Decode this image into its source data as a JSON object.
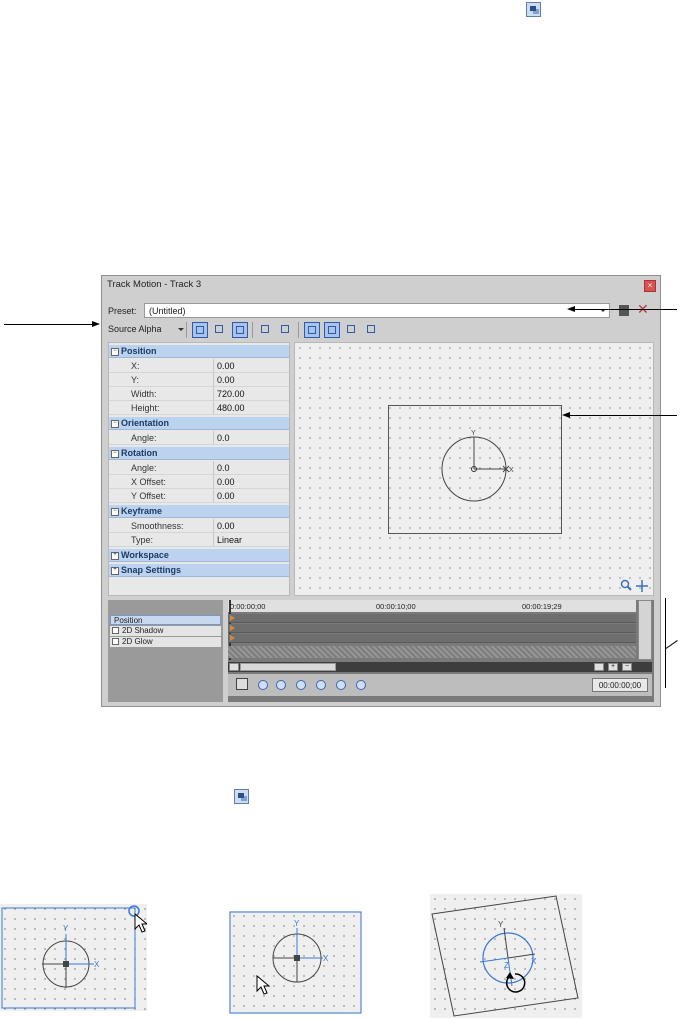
{
  "window": {
    "title": "Track Motion - Track 3",
    "close_symbol": "×"
  },
  "preset": {
    "label": "Preset:",
    "value": "(Untitled)",
    "delete_symbol": "✕"
  },
  "toolbar": {
    "source_alpha_label": "Source Alpha"
  },
  "properties": {
    "groups": [
      {
        "label": "Position",
        "expander": "−",
        "rows": [
          {
            "key": "X:",
            "value": "0.00"
          },
          {
            "key": "Y:",
            "value": "0.00"
          },
          {
            "key": "Width:",
            "value": "720.00"
          },
          {
            "key": "Height:",
            "value": "480.00"
          }
        ]
      },
      {
        "label": "Orientation",
        "expander": "−",
        "rows": [
          {
            "key": "Angle:",
            "value": "0.0"
          }
        ]
      },
      {
        "label": "Rotation",
        "expander": "−",
        "rows": [
          {
            "key": "Angle:",
            "value": "0.0"
          },
          {
            "key": "X Offset:",
            "value": "0.00"
          },
          {
            "key": "Y Offset:",
            "value": "0.00"
          }
        ]
      },
      {
        "label": "Keyframe",
        "expander": "−",
        "rows": [
          {
            "key": "Smoothness:",
            "value": "0.00"
          },
          {
            "key": "Type:",
            "value": "Linear"
          }
        ]
      },
      {
        "label": "Workspace",
        "expander": "+",
        "rows": []
      },
      {
        "label": "Snap Settings",
        "expander": "+",
        "rows": []
      }
    ]
  },
  "canvas": {
    "axis_y": "Y",
    "axis_x": "X"
  },
  "timeline": {
    "tracks": [
      "Position",
      "2D Shadow",
      "2D Glow"
    ],
    "ruler_labels": [
      "0:00:00;00",
      "00:00:10;00",
      "00:00:19;29"
    ],
    "current_time": "00:00:00;00",
    "scroll_plus": "+",
    "scroll_minus": "−"
  },
  "thumbnails": {
    "t1": {
      "y": "Y",
      "x": "X"
    },
    "t2": {
      "y": "Y",
      "x": "X"
    },
    "t3": {
      "y": "Y",
      "x": "X",
      "z": "Z"
    }
  },
  "colors": {
    "accent": "#2e5aa8",
    "group_header": "#bcd3ef",
    "handle_blue": "#3b78d8"
  }
}
